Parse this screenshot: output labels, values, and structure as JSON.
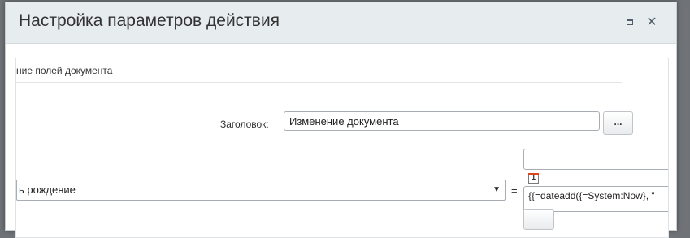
{
  "dialog": {
    "title": "Настройка параметров действия",
    "maximize_icon": "maximize-icon",
    "close_icon": "close-icon",
    "close_glyph": "✕"
  },
  "section": {
    "label": "ние полей документа"
  },
  "form": {
    "title_label": "Заголовок:",
    "title_value": "Изменение документа",
    "dots_label": "...",
    "field_select_value": "ь рождение",
    "select_arrow": "▼",
    "equals": "=",
    "calendar_icon": "calendar-icon",
    "calendar_day": "1",
    "expression_value": "{{=dateadd({=System:Now}, \""
  }
}
